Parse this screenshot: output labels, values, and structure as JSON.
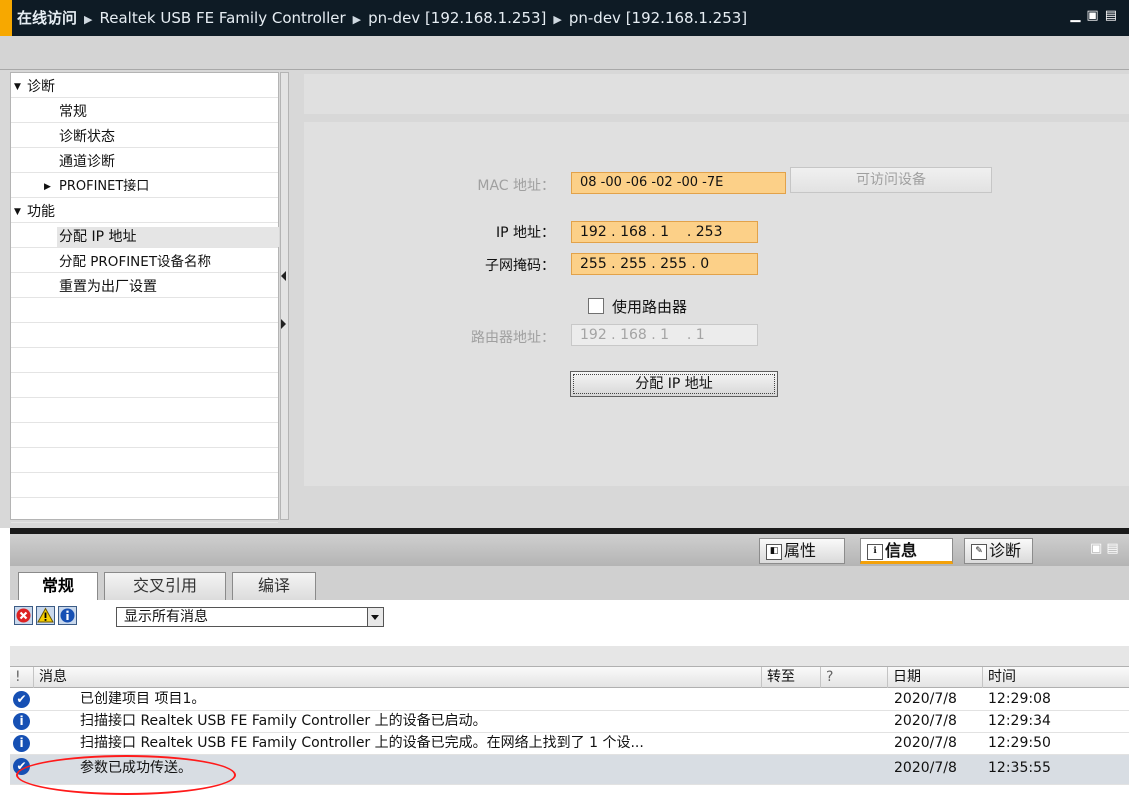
{
  "titlebar": {
    "breadcrumb": [
      "在线访问",
      "Realtek USB FE Family Controller",
      "pn-dev [192.168.1.253]",
      "pn-dev [192.168.1.253]"
    ],
    "accent_color": "#f7a800"
  },
  "tree": {
    "diagnostics": "诊断",
    "general": "常规",
    "diag_status": "诊断状态",
    "channel_diag": "通道诊断",
    "profinet_if": "PROFINET接口",
    "functions": "功能",
    "assign_ip": "分配 IP 地址",
    "assign_name": "分配 PROFINET设备名称",
    "reset_factory": "重置为出厂设置"
  },
  "form": {
    "mac_label": "MAC 地址：",
    "mac_value": "08 -00 -06 -02 -00 -7E",
    "accessible_btn": "可访问设备",
    "ip_label": "IP 地址：",
    "ip_value": "192 . 168 . 1    . 253",
    "mask_label": "子网掩码：",
    "mask_value": "255 . 255 . 255 . 0",
    "use_router": "使用路由器",
    "use_router_checked": false,
    "router_label": "路由器地址：",
    "router_value": "192 . 168 . 1    . 1",
    "assign_btn": "分配 IP 地址"
  },
  "inspector": {
    "tabs": [
      "属性",
      "信息",
      "诊断"
    ],
    "active_tab": "信息",
    "subtabs": [
      "常规",
      "交叉引用",
      "编译"
    ],
    "filter_value": "显示所有消息",
    "columns": {
      "bang": "!",
      "message": "消息",
      "goto": "转至",
      "q": "?",
      "date": "日期",
      "time": "时间"
    },
    "messages": [
      {
        "icon": "check",
        "text": "已创建项目 项目1。",
        "date": "2020/7/8",
        "time": "12:29:08"
      },
      {
        "icon": "info",
        "text": "扫描接口 Realtek USB FE Family Controller 上的设备已启动。",
        "date": "2020/7/8",
        "time": "12:29:34"
      },
      {
        "icon": "info",
        "text": "扫描接口 Realtek USB FE Family Controller 上的设备已完成。在网络上找到了 1 个设...",
        "date": "2020/7/8",
        "time": "12:29:50"
      },
      {
        "icon": "check",
        "text": "参数已成功传送。",
        "date": "2020/7/8",
        "time": "12:35:55"
      }
    ]
  }
}
